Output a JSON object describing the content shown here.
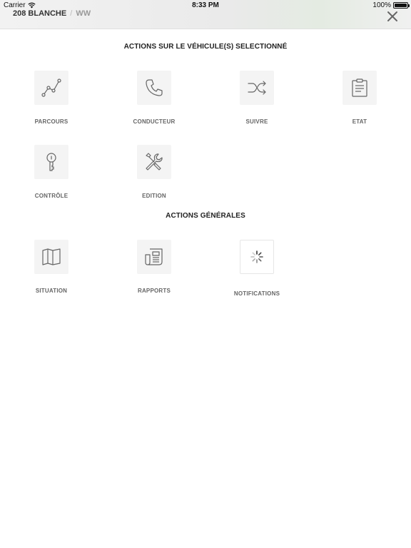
{
  "status_bar": {
    "carrier": "Carrier",
    "time": "8:33 PM",
    "battery": "100%"
  },
  "header": {
    "vehicle_name": "208 BLANCHE",
    "separator": "/",
    "vehicle_sub": "WW",
    "close_icon": "close-icon"
  },
  "sections": {
    "vehicle_actions_title": "ACTIONS SUR LE VÉHICULE(S) SELECTIONNÉ",
    "general_actions_title": "ACTIONS GÉNÉRALES"
  },
  "vehicle_actions": [
    {
      "label": "PARCOURS",
      "icon": "route-icon"
    },
    {
      "label": "CONDUCTEUR",
      "icon": "phone-icon"
    },
    {
      "label": "SUIVRE",
      "icon": "shuffle-icon"
    },
    {
      "label": "ETAT",
      "icon": "clipboard-icon"
    },
    {
      "label": "CONTRÔLE",
      "icon": "key-icon"
    },
    {
      "label": "EDITION",
      "icon": "tools-icon"
    }
  ],
  "general_actions": [
    {
      "label": "SITUATION",
      "icon": "map-icon"
    },
    {
      "label": "RAPPORTS",
      "icon": "newspaper-icon"
    },
    {
      "label": "NOTIFICATIONS",
      "icon": "loading-spinner-icon"
    }
  ],
  "colors": {
    "icon_stroke": "#666666",
    "tile_bg": "#f4f4f4",
    "label": "#666666"
  }
}
